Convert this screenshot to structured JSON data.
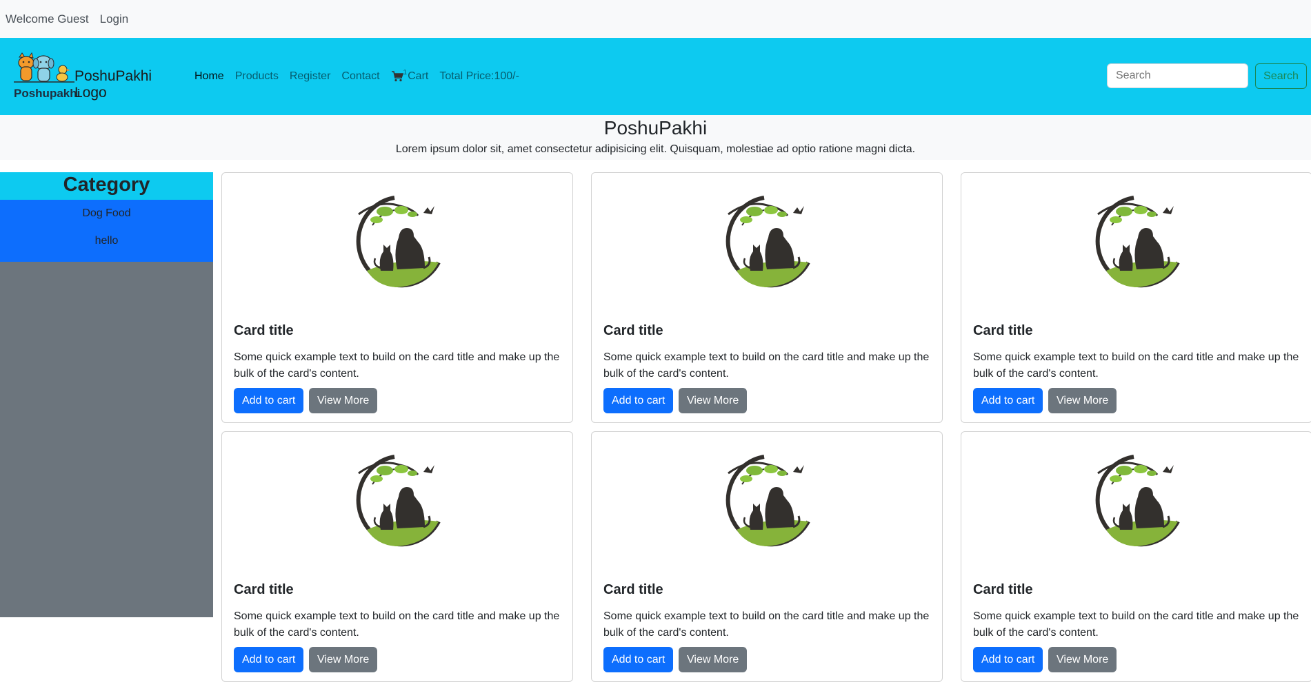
{
  "topbar": {
    "welcome": "Welcome Guest",
    "login": "Login"
  },
  "brand": {
    "logo_caption": "Poshupakhi",
    "logo_text": "PoshuPakhi Logo"
  },
  "nav": {
    "home": "Home",
    "products": "Products",
    "register": "Register",
    "contact": "Contact",
    "cart_count": "1",
    "cart": "Cart",
    "total_price": "Total Price:100/-"
  },
  "search": {
    "placeholder": "Search",
    "button": "Search"
  },
  "hero": {
    "title": "PoshuPakhi",
    "subtitle": "Lorem ipsum dolor sit, amet consectetur adipisicing elit. Quisquam, molestiae ad optio ratione magni dicta."
  },
  "sidebar": {
    "heading": "Category",
    "items": [
      {
        "label": "Dog Food"
      },
      {
        "label": "hello"
      }
    ]
  },
  "cards": [
    {
      "title": "Card title",
      "text": "Some quick example text to build on the card title and make up the bulk of the card's content.",
      "add_label": "Add to cart",
      "more_label": "View More"
    },
    {
      "title": "Card title",
      "text": "Some quick example text to build on the card title and make up the bulk of the card's content.",
      "add_label": "Add to cart",
      "more_label": "View More"
    },
    {
      "title": "Card title",
      "text": "Some quick example text to build on the card title and make up the bulk of the card's content.",
      "add_label": "Add to cart",
      "more_label": "View More"
    },
    {
      "title": "Card title",
      "text": "Some quick example text to build on the card title and make up the bulk of the card's content.",
      "add_label": "Add to cart",
      "more_label": "View More"
    },
    {
      "title": "Card title",
      "text": "Some quick example text to build on the card title and make up the bulk of the card's content.",
      "add_label": "Add to cart",
      "more_label": "View More"
    },
    {
      "title": "Card title",
      "text": "Some quick example text to build on the card title and make up the bulk of the card's content.",
      "add_label": "Add to cart",
      "more_label": "View More"
    }
  ],
  "colors": {
    "navbar": "#0dcaf0",
    "primary": "#0d6efd",
    "secondary": "#6c757d",
    "success": "#198754",
    "light": "#f8f9fa"
  }
}
